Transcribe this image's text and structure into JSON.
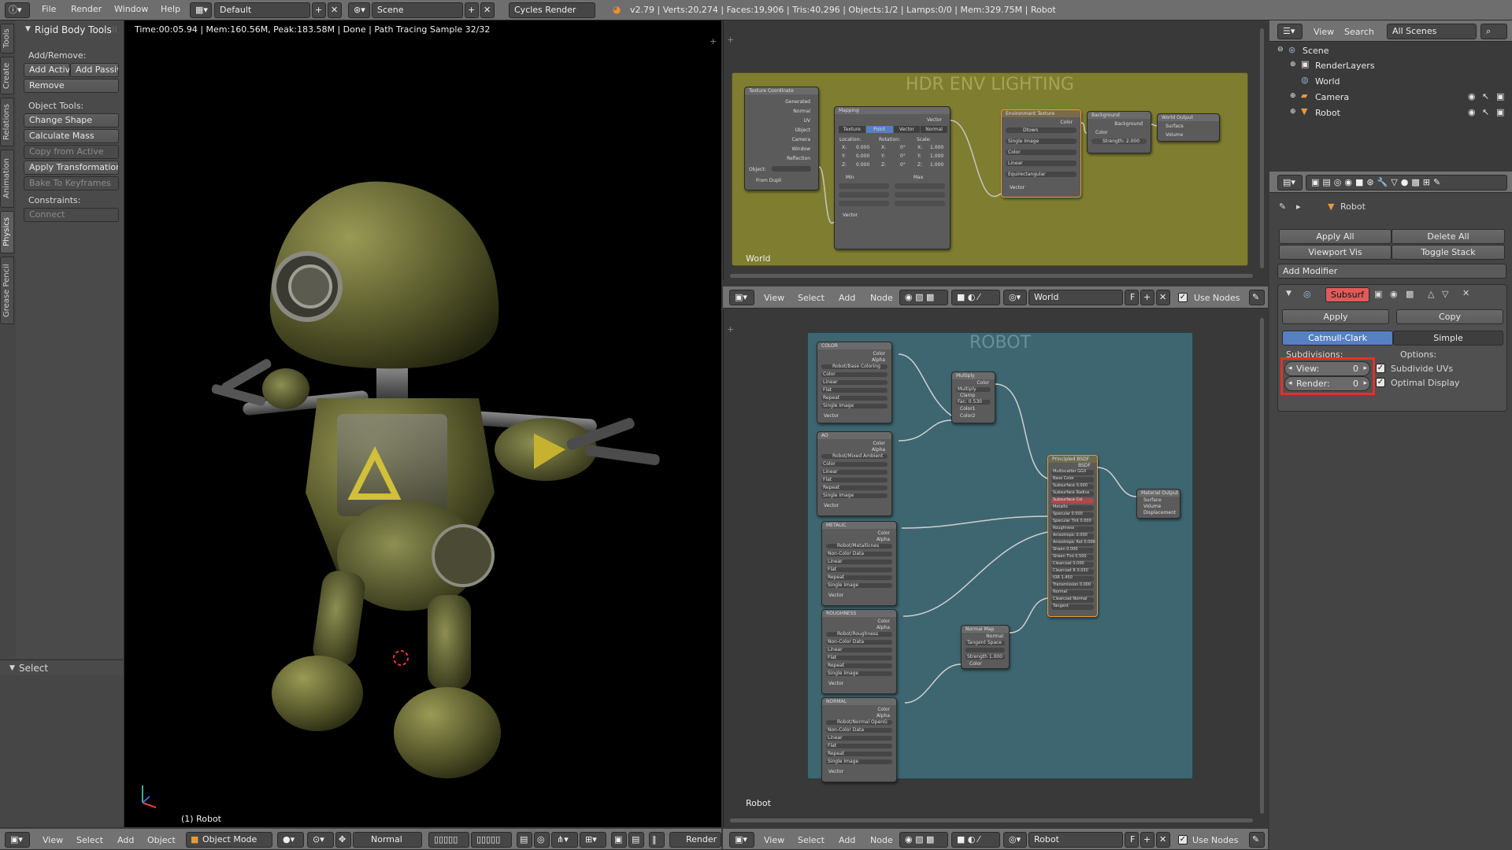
{
  "topbar": {
    "menus": [
      "File",
      "Render",
      "Window",
      "Help"
    ],
    "layout": "Default",
    "scene": "Scene",
    "engine": "Cycles Render",
    "stats": "v2.79 | Verts:20,274 | Faces:19,906 | Tris:40,296 | Objects:1/2 | Lamps:0/0 | Mem:329.75M | Robot"
  },
  "toolshelf": {
    "tabs": [
      "Tools",
      "Create",
      "Relations",
      "Animation",
      "Physics",
      "Grease Pencil"
    ],
    "panel_title": "Rigid Body Tools",
    "add_remove_label": "Add/Remove:",
    "add_active": "Add Activ",
    "add_passive": "Add Passiv",
    "remove": "Remove",
    "object_tools_label": "Object Tools:",
    "change_shape": "Change Shape",
    "calculate_mass": "Calculate Mass",
    "copy_from_active": "Copy from Active",
    "apply_transformation": "Apply Transformation",
    "bake_to_keyframes": "Bake To Keyframes",
    "constraints_label": "Constraints:",
    "connect": "Connect",
    "select_panel": "Select"
  },
  "viewport": {
    "render_info": "Time:00:05.94 | Mem:160.56M, Peak:183.58M | Done | Path Tracing Sample 32/32",
    "object_label": "(1) Robot",
    "menus": [
      "View",
      "Select",
      "Add",
      "Object"
    ],
    "mode": "Object Mode",
    "orientation": "Normal",
    "render_btn": "Render"
  },
  "world_nodes": {
    "frame_title": "HDR ENV LIGHTING",
    "label": "World",
    "texcoord_title": "Texture Coordinate",
    "texcoord_outputs": [
      "Generated",
      "Normal",
      "UV",
      "Object",
      "Camera",
      "Window",
      "Reflection"
    ],
    "texcoord_object": "Object:",
    "texcoord_dupli": "From Dupli",
    "mapping_title": "Mapping",
    "mapping_out": "Vector",
    "mapping_tabs": [
      "Texture",
      "Point",
      "Vector",
      "Normal"
    ],
    "mapping_heads": [
      "Location:",
      "Rotation:",
      "Scale:"
    ],
    "mapping_rows": [
      [
        "X:",
        "0.000",
        "X:",
        "0°",
        "X:",
        "1.000"
      ],
      [
        "Y:",
        "0.000",
        "Y:",
        "0°",
        "Y:",
        "1.000"
      ],
      [
        "Z:",
        "0.000",
        "Z:",
        "0°",
        "Z:",
        "1.000"
      ]
    ],
    "mapping_min": "Min",
    "mapping_max": "Max",
    "mapping_in": "Vector",
    "env_title": "Environment Texture",
    "env_out": "Color",
    "env_image": "Dtown",
    "env_opts": [
      "Single Image",
      "Color",
      "Linear",
      "Equirectangular"
    ],
    "env_in": "Vector",
    "bg_title": "Background",
    "bg_out": "Background",
    "bg_color": "Color",
    "bg_strength": "Strength: 2.000",
    "wo_title": "World Output",
    "wo_inputs": [
      "Surface",
      "Volume"
    ]
  },
  "node_header_world": {
    "menus": [
      "View",
      "Select",
      "Add",
      "Node"
    ],
    "datablock": "World",
    "fake_user": "F",
    "use_nodes": "Use Nodes"
  },
  "robot_nodes": {
    "frame_title": "ROBOT",
    "label": "Robot",
    "tex_titles": [
      "COLOR",
      "AO",
      "METALIC",
      "ROUGHNESS",
      "NORMAL"
    ],
    "tex_images": [
      "Robot/Base Coloring",
      "Robot/Mixed Ambient",
      "Robot/Metallicnes",
      "Robot/Roughness",
      "Robot/Normal OpenG"
    ],
    "tex_outs": [
      "Color",
      "Alpha"
    ],
    "tex_opts": [
      "Color",
      "Non-Color Data",
      "Linear",
      "Flat",
      "Repeat",
      "Single Image"
    ],
    "tex_in": "Vector",
    "multiply_title": "Multiply",
    "multiply_out": "Color",
    "multiply_opts": [
      "Multiply",
      "Clamp",
      "Fac: 0.530",
      "Color1",
      "Color2"
    ],
    "principled_title": "Principled BSDF",
    "principled_out": "BSDF",
    "principled_rows": [
      "Multiscatter GGX",
      "Base Color",
      "Subsurface 0.000",
      "Subsurface Radius",
      "Subsurface Col",
      "Metallic",
      "Specular 0.500",
      "Specular Tint 0.000",
      "Roughness",
      "Anisotropic 0.000",
      "Anisotropic Rot 0.000",
      "Sheen 0.000",
      "Sheen Tint 0.500",
      "Clearcoat 0.000",
      "Clearcoat R 0.030",
      "IOR 1.450",
      "Transmission 0.000",
      "Normal",
      "Clearcoat Normal",
      "Tangent"
    ],
    "normalmap_title": "Normal Map",
    "normalmap_rows": [
      "Normal",
      "Tangent Space",
      "",
      "Strength 1.000",
      "Color"
    ],
    "mo_title": "Material Output",
    "mo_inputs": [
      "Surface",
      "Volume",
      "Displacement"
    ]
  },
  "node_header_robot": {
    "menus": [
      "View",
      "Select",
      "Add",
      "Node"
    ],
    "datablock": "Robot",
    "fake_user": "F",
    "use_nodes": "Use Nodes"
  },
  "outliner": {
    "menus": [
      "View",
      "Search"
    ],
    "filter": "All Scenes",
    "items": [
      "Scene",
      "RenderLayers",
      "World",
      "Camera",
      "Robot"
    ]
  },
  "properties": {
    "breadcrumb": "Robot",
    "apply_all": "Apply All",
    "delete_all": "Delete All",
    "viewport_vis": "Viewport Vis",
    "toggle_stack": "Toggle Stack",
    "add_modifier": "Add Modifier",
    "modifier_name": "Subsurf",
    "apply": "Apply",
    "copy": "Copy",
    "catmull": "Catmull-Clark",
    "simple": "Simple",
    "subdivisions_label": "Subdivisions:",
    "options_label": "Options:",
    "view_label": "View:",
    "view_value": "0",
    "render_label": "Render:",
    "render_value": "0",
    "subdivide_uvs": "Subdivide UVs",
    "optimal_display": "Optimal Display"
  },
  "colors": {
    "world_frame": "#7f7e30",
    "robot_frame": "#3d6670",
    "highlight": "#e0322a",
    "accent_blue": "#5680c2",
    "modifier_red": "#e15a5a"
  }
}
